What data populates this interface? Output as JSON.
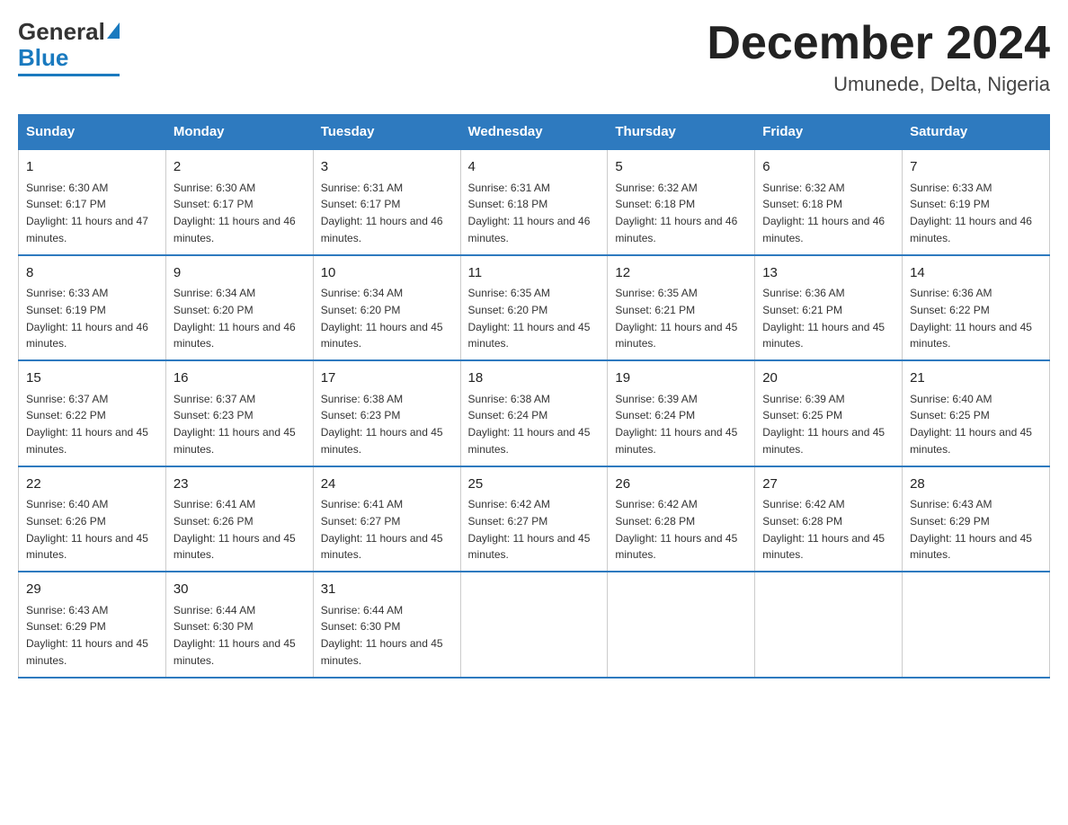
{
  "header": {
    "logo": {
      "general": "General",
      "blue": "Blue"
    },
    "title": "December 2024",
    "location": "Umunede, Delta, Nigeria"
  },
  "days_of_week": [
    "Sunday",
    "Monday",
    "Tuesday",
    "Wednesday",
    "Thursday",
    "Friday",
    "Saturday"
  ],
  "weeks": [
    [
      {
        "day": "1",
        "sunrise": "6:30 AM",
        "sunset": "6:17 PM",
        "daylight": "11 hours and 47 minutes."
      },
      {
        "day": "2",
        "sunrise": "6:30 AM",
        "sunset": "6:17 PM",
        "daylight": "11 hours and 46 minutes."
      },
      {
        "day": "3",
        "sunrise": "6:31 AM",
        "sunset": "6:17 PM",
        "daylight": "11 hours and 46 minutes."
      },
      {
        "day": "4",
        "sunrise": "6:31 AM",
        "sunset": "6:18 PM",
        "daylight": "11 hours and 46 minutes."
      },
      {
        "day": "5",
        "sunrise": "6:32 AM",
        "sunset": "6:18 PM",
        "daylight": "11 hours and 46 minutes."
      },
      {
        "day": "6",
        "sunrise": "6:32 AM",
        "sunset": "6:18 PM",
        "daylight": "11 hours and 46 minutes."
      },
      {
        "day": "7",
        "sunrise": "6:33 AM",
        "sunset": "6:19 PM",
        "daylight": "11 hours and 46 minutes."
      }
    ],
    [
      {
        "day": "8",
        "sunrise": "6:33 AM",
        "sunset": "6:19 PM",
        "daylight": "11 hours and 46 minutes."
      },
      {
        "day": "9",
        "sunrise": "6:34 AM",
        "sunset": "6:20 PM",
        "daylight": "11 hours and 46 minutes."
      },
      {
        "day": "10",
        "sunrise": "6:34 AM",
        "sunset": "6:20 PM",
        "daylight": "11 hours and 45 minutes."
      },
      {
        "day": "11",
        "sunrise": "6:35 AM",
        "sunset": "6:20 PM",
        "daylight": "11 hours and 45 minutes."
      },
      {
        "day": "12",
        "sunrise": "6:35 AM",
        "sunset": "6:21 PM",
        "daylight": "11 hours and 45 minutes."
      },
      {
        "day": "13",
        "sunrise": "6:36 AM",
        "sunset": "6:21 PM",
        "daylight": "11 hours and 45 minutes."
      },
      {
        "day": "14",
        "sunrise": "6:36 AM",
        "sunset": "6:22 PM",
        "daylight": "11 hours and 45 minutes."
      }
    ],
    [
      {
        "day": "15",
        "sunrise": "6:37 AM",
        "sunset": "6:22 PM",
        "daylight": "11 hours and 45 minutes."
      },
      {
        "day": "16",
        "sunrise": "6:37 AM",
        "sunset": "6:23 PM",
        "daylight": "11 hours and 45 minutes."
      },
      {
        "day": "17",
        "sunrise": "6:38 AM",
        "sunset": "6:23 PM",
        "daylight": "11 hours and 45 minutes."
      },
      {
        "day": "18",
        "sunrise": "6:38 AM",
        "sunset": "6:24 PM",
        "daylight": "11 hours and 45 minutes."
      },
      {
        "day": "19",
        "sunrise": "6:39 AM",
        "sunset": "6:24 PM",
        "daylight": "11 hours and 45 minutes."
      },
      {
        "day": "20",
        "sunrise": "6:39 AM",
        "sunset": "6:25 PM",
        "daylight": "11 hours and 45 minutes."
      },
      {
        "day": "21",
        "sunrise": "6:40 AM",
        "sunset": "6:25 PM",
        "daylight": "11 hours and 45 minutes."
      }
    ],
    [
      {
        "day": "22",
        "sunrise": "6:40 AM",
        "sunset": "6:26 PM",
        "daylight": "11 hours and 45 minutes."
      },
      {
        "day": "23",
        "sunrise": "6:41 AM",
        "sunset": "6:26 PM",
        "daylight": "11 hours and 45 minutes."
      },
      {
        "day": "24",
        "sunrise": "6:41 AM",
        "sunset": "6:27 PM",
        "daylight": "11 hours and 45 minutes."
      },
      {
        "day": "25",
        "sunrise": "6:42 AM",
        "sunset": "6:27 PM",
        "daylight": "11 hours and 45 minutes."
      },
      {
        "day": "26",
        "sunrise": "6:42 AM",
        "sunset": "6:28 PM",
        "daylight": "11 hours and 45 minutes."
      },
      {
        "day": "27",
        "sunrise": "6:42 AM",
        "sunset": "6:28 PM",
        "daylight": "11 hours and 45 minutes."
      },
      {
        "day": "28",
        "sunrise": "6:43 AM",
        "sunset": "6:29 PM",
        "daylight": "11 hours and 45 minutes."
      }
    ],
    [
      {
        "day": "29",
        "sunrise": "6:43 AM",
        "sunset": "6:29 PM",
        "daylight": "11 hours and 45 minutes."
      },
      {
        "day": "30",
        "sunrise": "6:44 AM",
        "sunset": "6:30 PM",
        "daylight": "11 hours and 45 minutes."
      },
      {
        "day": "31",
        "sunrise": "6:44 AM",
        "sunset": "6:30 PM",
        "daylight": "11 hours and 45 minutes."
      },
      null,
      null,
      null,
      null
    ]
  ]
}
